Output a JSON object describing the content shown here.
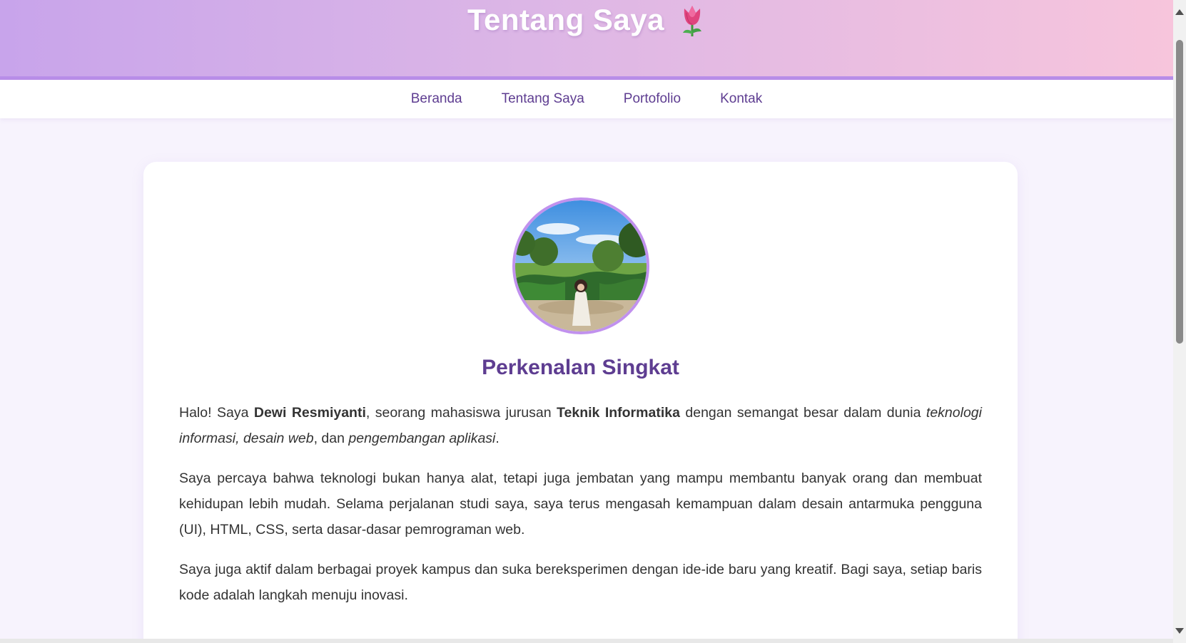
{
  "header": {
    "title": "Tentang Saya",
    "emoji_icon": "tulip-icon",
    "gradient_start": "#c8a4eb",
    "gradient_end": "#f7c5dc"
  },
  "nav": {
    "items": [
      {
        "label": "Beranda"
      },
      {
        "label": "Tentang Saya"
      },
      {
        "label": "Portofolio"
      },
      {
        "label": "Kontak"
      }
    ]
  },
  "profile": {
    "avatar_icon": "profile-photo",
    "section_title": "Perkenalan Singkat"
  },
  "paragraphs": {
    "p1": {
      "t1": "Halo! Saya ",
      "name": "Dewi Resmiyanti",
      "t2": ", seorang mahasiswa jurusan ",
      "major": "Teknik Informatika",
      "t3": " dengan semangat besar dalam dunia ",
      "focus1": "teknologi informasi, desain web",
      "t4": ", dan ",
      "focus2": "pengembangan aplikasi",
      "t5": "."
    },
    "p2": "Saya percaya bahwa teknologi bukan hanya alat, tetapi juga jembatan yang mampu membantu banyak orang dan membuat kehidupan lebih mudah. Selama perjalanan studi saya, saya terus mengasah kemampuan dalam desain antarmuka pengguna (UI), HTML, CSS, serta dasar-dasar pemrograman web.",
    "p3": "Saya juga aktif dalam berbagai proyek kampus dan suka bereksperimen dengan ide-ide baru yang kreatif. Bagi saya, setiap baris kode adalah langkah menuju inovasi."
  },
  "colors": {
    "accent": "#5e3d91",
    "avatar_border": "#c191ee",
    "background": "#f7f3fd"
  }
}
